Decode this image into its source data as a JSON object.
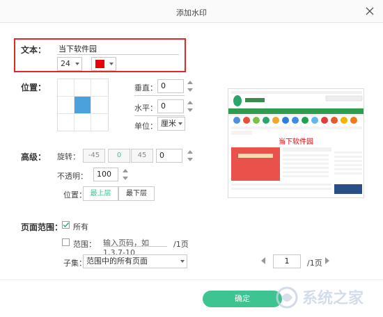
{
  "dialog": {
    "title": "添加水印"
  },
  "text_section": {
    "label": "文本：",
    "value": "当下软件园",
    "font_size": "24",
    "color": "#e8000a"
  },
  "position_section": {
    "label": "位置：",
    "vertical_label": "垂直：",
    "vertical_value": "0",
    "horizontal_label": "水平：",
    "horizontal_value": "0",
    "unit_label": "单位：",
    "unit_value": "厘米"
  },
  "advanced_section": {
    "label": "高级：",
    "rotate_label": "旋转：",
    "rotations": [
      "-45",
      "0",
      "45"
    ],
    "rotate_value": "0",
    "opacity_label": "不透明：",
    "opacity_value": "100",
    "layer_label": "位置：",
    "layer_top": "最上层",
    "layer_bottom": "最下层"
  },
  "page_range": {
    "label": "页面范围：",
    "all_label": "所有",
    "range_label": "范围：",
    "range_placeholder": "输入页码，如1,3,7-10",
    "range_suffix": "/1页",
    "subset_label": "子集：",
    "subset_value": "范围中的所有页面"
  },
  "pager": {
    "current": "1",
    "total": "/1页"
  },
  "preview": {
    "watermark_text": "当下软件园",
    "site_name": "当下软件园"
  },
  "confirm_label": "确定",
  "watermark_logo": "系统之家",
  "colors": {
    "accent": "#3ec490",
    "highlight": "#e0262a",
    "grid_active": "#4aa1dc"
  }
}
